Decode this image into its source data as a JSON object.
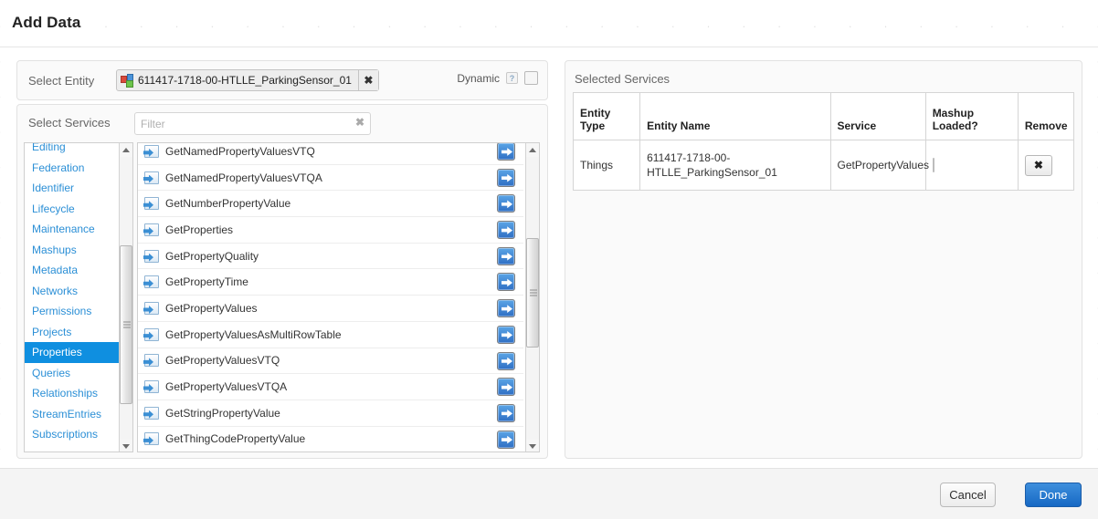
{
  "header": {
    "title": "Add Data"
  },
  "entity_section": {
    "label": "Select Entity",
    "chip": {
      "icon": "things-blocks-icon",
      "text": "611417-1718-00-HTLLE_ParkingSensor_01",
      "remove_glyph": "✖"
    },
    "dynamic": {
      "label": "Dynamic",
      "help_glyph": "?",
      "checked": false
    }
  },
  "services_section": {
    "label": "Select Services",
    "filter": {
      "placeholder": "Filter",
      "value": "",
      "clear_glyph": "✖"
    },
    "categories": [
      {
        "label": "Editing",
        "selected": false
      },
      {
        "label": "Federation",
        "selected": false
      },
      {
        "label": "Identifier",
        "selected": false
      },
      {
        "label": "Lifecycle",
        "selected": false
      },
      {
        "label": "Maintenance",
        "selected": false
      },
      {
        "label": "Mashups",
        "selected": false
      },
      {
        "label": "Metadata",
        "selected": false
      },
      {
        "label": "Networks",
        "selected": false
      },
      {
        "label": "Permissions",
        "selected": false
      },
      {
        "label": "Projects",
        "selected": false
      },
      {
        "label": "Properties",
        "selected": true
      },
      {
        "label": "Queries",
        "selected": false
      },
      {
        "label": "Relationships",
        "selected": false
      },
      {
        "label": "StreamEntries",
        "selected": false
      },
      {
        "label": "Subscriptions",
        "selected": false
      }
    ],
    "services": [
      {
        "name": "GetNamedPropertyValuesVTQ"
      },
      {
        "name": "GetNamedPropertyValuesVTQA"
      },
      {
        "name": "GetNumberPropertyValue"
      },
      {
        "name": "GetProperties"
      },
      {
        "name": "GetPropertyQuality"
      },
      {
        "name": "GetPropertyTime"
      },
      {
        "name": "GetPropertyValues"
      },
      {
        "name": "GetPropertyValuesAsMultiRowTable"
      },
      {
        "name": "GetPropertyValuesVTQ"
      },
      {
        "name": "GetPropertyValuesVTQA"
      },
      {
        "name": "GetStringPropertyValue"
      },
      {
        "name": "GetThingCodePropertyValue"
      }
    ]
  },
  "selected_section": {
    "label": "Selected Services",
    "columns": [
      "Entity Type",
      "Entity Name",
      "Service",
      "Mashup Loaded?",
      "Remove"
    ],
    "columns_split": [
      [
        "Entity",
        "Type"
      ],
      [
        "Entity Name"
      ],
      [
        "Service"
      ],
      [
        "Mashup",
        "Loaded?"
      ],
      [
        "Remove"
      ]
    ],
    "rows": [
      {
        "entity_type": "Things",
        "entity_name": "611417-1718-00-HTLLE_ParkingSensor_01",
        "service": "GetPropertyValues",
        "mashup_loaded": false,
        "remove_glyph": "✖"
      }
    ]
  },
  "footer": {
    "cancel_label": "Cancel",
    "done_label": "Done"
  },
  "colors": {
    "accent_blue": "#0f8fe0",
    "link_blue": "#2b8fd6",
    "done_button": "#1668c4",
    "panel_bg": "#fafafa"
  }
}
